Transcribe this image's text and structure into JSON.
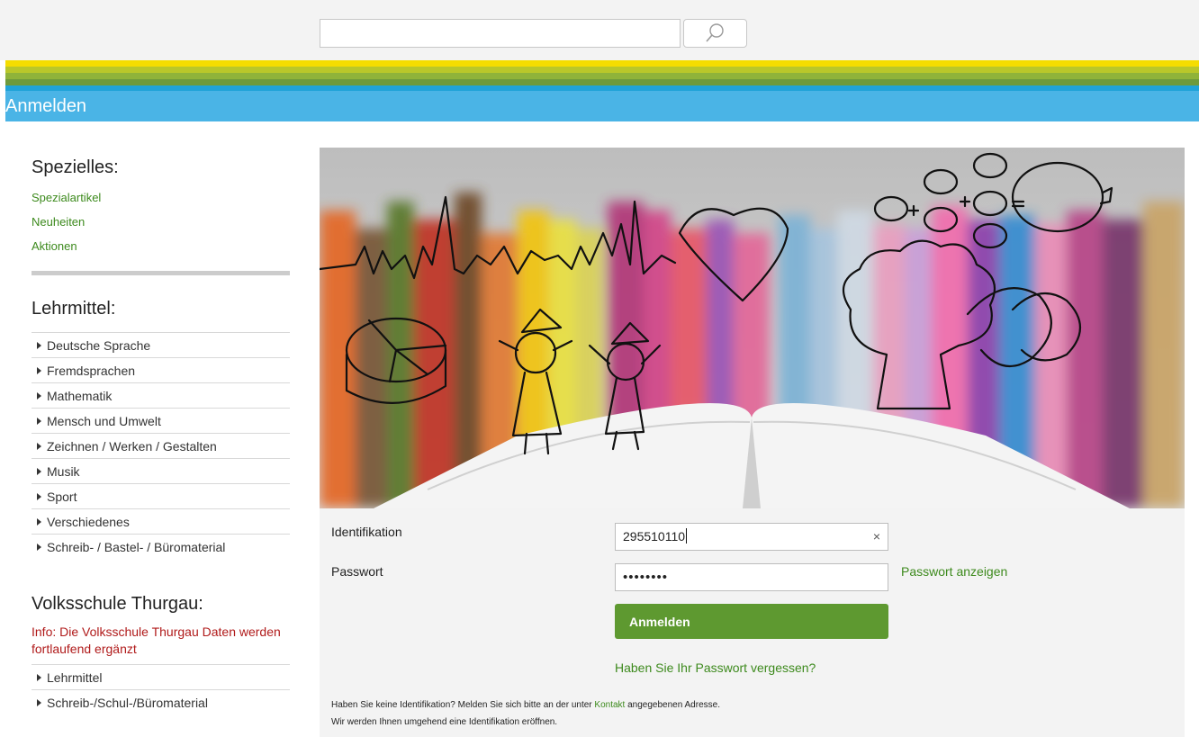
{
  "search": {
    "value": "",
    "placeholder": ""
  },
  "title_bar": {
    "title": "Anmelden"
  },
  "sidebar": {
    "special_heading": "Spezielles:",
    "special_links": [
      "Spezialartikel",
      "Neuheiten",
      "Aktionen"
    ],
    "lehrmittel_heading": "Lehrmittel:",
    "lehrmittel_items": [
      "Deutsche Sprache",
      "Fremdsprachen",
      "Mathematik",
      "Mensch und Umwelt",
      "Zeichnen / Werken / Gestalten",
      "Musik",
      "Sport",
      "Verschiedenes",
      "Schreib- / Bastel- / Büromaterial"
    ],
    "volksschule_heading": "Volksschule Thurgau:",
    "volksschule_info": "Info: Die Volksschule Thurgau Daten werden fortlaufend ergänzt",
    "volksschule_items": [
      "Lehrmittel",
      "Schreib-/Schul-/Büromaterial"
    ]
  },
  "form": {
    "id_label": "Identifikation",
    "id_value": "295510110",
    "clear_glyph": "×",
    "pw_label": "Passwort",
    "pw_masked": "••••••••",
    "show_password": "Passwort anzeigen",
    "submit_label": "Anmelden",
    "forgot_password": "Haben Sie Ihr Passwort vergessen?",
    "note_line1_before": "Haben Sie keine Identifikation? Melden Sie sich bitte an der unter ",
    "note_link": "Kontakt",
    "note_line1_after": " angegebenen Adresse.",
    "note_line2": "Wir werden Ihnen umgehend eine Identifikation eröffnen."
  },
  "colors": {
    "accent_blue": "#4ab4e6",
    "link_green": "#3d8a1d",
    "button_green": "#5e9930",
    "info_red": "#b01a1a"
  },
  "icons": {
    "search": "search-icon",
    "bullet": "triangle-right-icon"
  }
}
